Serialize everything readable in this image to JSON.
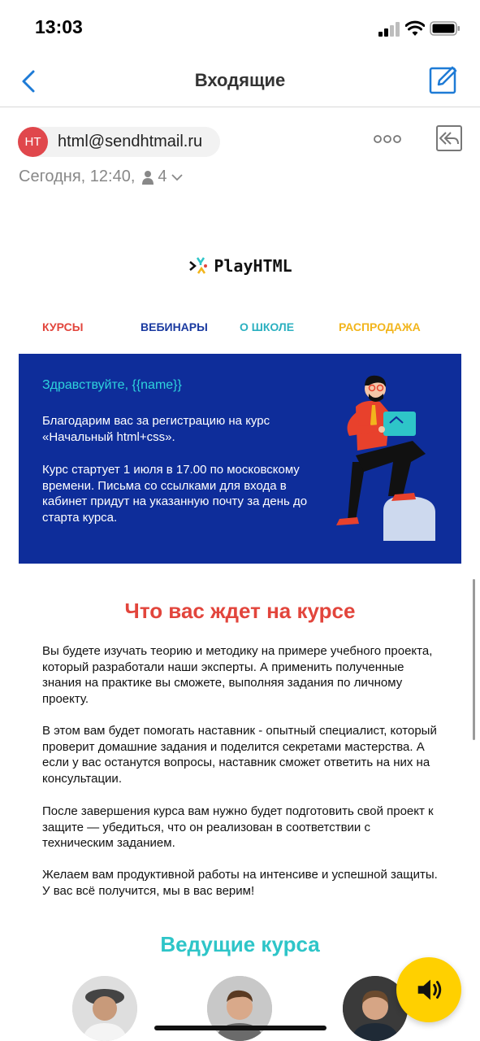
{
  "status_bar": {
    "time": "13:03"
  },
  "nav": {
    "title": "Входящие"
  },
  "sender": {
    "initials": "HT",
    "email": "html@sendhtmail.ru",
    "date": "Сегодня, 12:40,",
    "recipients_count": "4"
  },
  "email": {
    "logo_text": "PlayHTML",
    "menu": [
      {
        "label": "КУРСЫ",
        "color": "#e2453c"
      },
      {
        "label": "ВЕБИНАРЫ",
        "color": "#1a3aa0"
      },
      {
        "label": "О ШКОЛЕ",
        "color": "#2bb0c0"
      },
      {
        "label": "РАСПРОДАЖА",
        "color": "#f2b51c"
      }
    ],
    "hero": {
      "greeting": "Здравствуйте, {{name}}",
      "p1": "Благодарим вас за регистрацию на курс «Начальный html+css».",
      "p2": "Курс стартует 1 июля в 17.00 по московскому времени. Письма со ссылками для входа в кабинет придут на указанную почту за день до старта курса.",
      "background": "#0e2d9a"
    },
    "section1_title": "Что вас ждет на курсе",
    "paragraphs": [
      "Вы будете изучать теорию и методику на примере учебного проекта, который разработали наши эксперты. А применить полученные знания на практике вы сможете, выполняя задания по личному проекту.",
      "В этом вам будет помогать наставник - опытный специалист, который проверит домашние задания и поделится секретами мастерства. А если у вас останутся вопросы, наставник сможет ответить на них на консультации.",
      "После завершения курса вам нужно будет подготовить свой проект к защите — убедиться, что он реализован в соответствии с техническим заданием.",
      "Желаем вам продуктивной работы на интенсиве и успешной защиты. У вас всё получится, мы в вас верим!"
    ],
    "section2_title": "Ведущие курса"
  },
  "colors": {
    "accent_blue": "#1e7bd6",
    "avatar_red": "#e0474c",
    "audio_yellow": "#ffd000"
  }
}
